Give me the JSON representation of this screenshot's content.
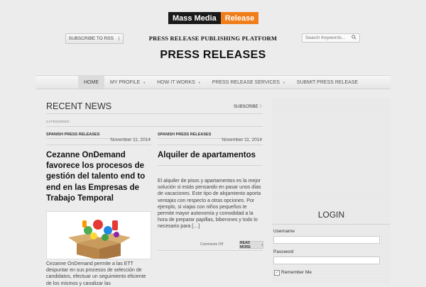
{
  "logo": {
    "part1": "Mass Media",
    "part2": "Release"
  },
  "header": {
    "rss_label": "SUBSCRIBE TO RSS",
    "tagline": "PRESS RELEASE PUBLISHING PLATFORM",
    "search_placeholder": "Search Keywords...",
    "site_title": "PRESS RELEASES"
  },
  "nav": {
    "items": [
      {
        "label": "HOME"
      },
      {
        "label": "MY PROFILE"
      },
      {
        "label": "HOW IT WORKS"
      },
      {
        "label": "PRESS RELEASE SERVICES"
      },
      {
        "label": "SUBMIT PRESS RELEASE"
      }
    ]
  },
  "main": {
    "heading": "RECENT NEWS",
    "subscribe_label": "SUBSCRIBE",
    "categories_label": "CATEGORIES:",
    "posts": [
      {
        "category": "SPANISH PRESS RELEASES",
        "date": "November 11, 2014",
        "title": "Cezanne OnDemand favorece los procesos de gestión del talento end to end en las Empresas de Trabajo Temporal",
        "excerpt": "Cezanne OnDemand permite a las ETT despuntar en sus procesos de selección de candidatos, efectuar un seguimiento eficiente de los mismos y canalizar las"
      },
      {
        "category": "SPANISH PRESS RELEASES",
        "date": "November 11, 2014",
        "title": "Alquiler de apartamentos",
        "excerpt": "El alquiler de pisos y apartamentos es la mejor solución si estás pensando en pasar unos días de vacaciones. Este tipo de alojamiento aporta ventajas con respecto a otras opciones. Por ejemplo, si viajas con niños pequeños te permite mayor autonomía y comodidad a la hora de preparar papillas, biberones y todo lo necesario para […]",
        "comments": "Comments Off",
        "more_label": "READ MORE"
      }
    ]
  },
  "sidebar": {
    "login_title": "LOGIN",
    "username_label": "Username",
    "password_label": "Password",
    "remember_label": "Remember Me",
    "remember_checked": true
  },
  "icons": {
    "rss": "rss-icon",
    "search": "search-icon",
    "caret": "chevron-down-icon",
    "more": "chevron-right-icon"
  },
  "colors": {
    "logo_dark": "#1a1a1a",
    "logo_accent": "#f07c1a",
    "background": "#ececec"
  }
}
